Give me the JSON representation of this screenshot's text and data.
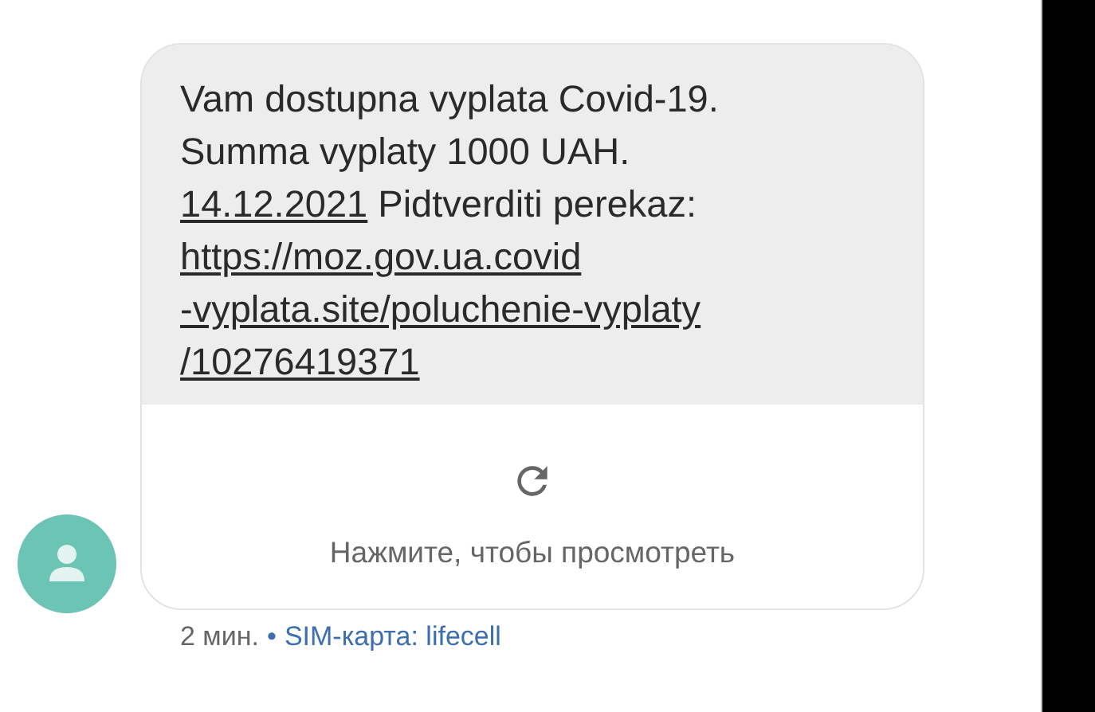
{
  "message": {
    "lines": [
      {
        "kind": "text",
        "text": "Vam dostupna vyplata Covid-19."
      },
      {
        "kind": "text",
        "text": "Summa vyplaty 1000 UAH."
      },
      {
        "kind": "date_text",
        "date": "14.12.2021",
        "text": "Pidtverditi perekaz:"
      },
      {
        "kind": "link",
        "text": "https://moz.gov.ua.covid"
      },
      {
        "kind": "link",
        "text": "-vyplata.site/poluchenie-vyplaty"
      },
      {
        "kind": "link",
        "text": "/10276419371"
      }
    ],
    "preview": {
      "label": "Нажмите, чтобы просмотреть"
    }
  },
  "footer": {
    "time": "2 мин.",
    "separator": "•",
    "sim": "SIM-карта: lifecell"
  }
}
